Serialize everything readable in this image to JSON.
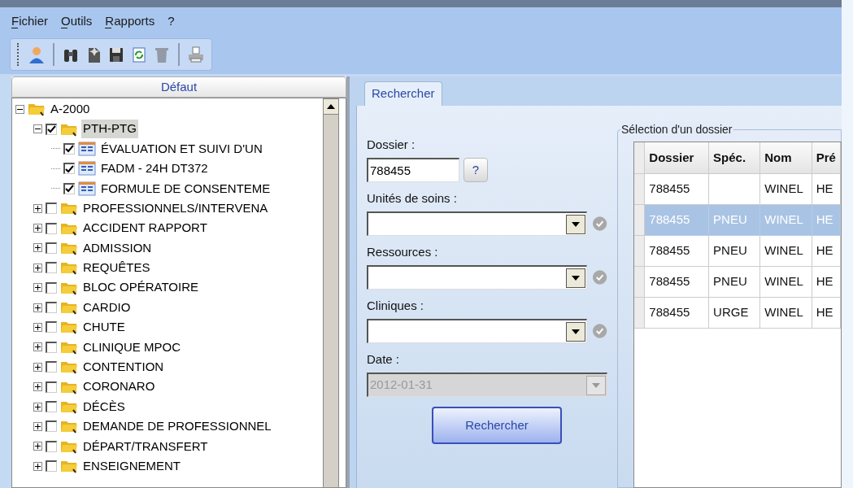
{
  "menu": [
    {
      "label": "Fichier",
      "mnemonic": true
    },
    {
      "label": "Outils",
      "mnemonic": true
    },
    {
      "label": "Rapports",
      "mnemonic": true
    },
    {
      "label": "?",
      "mnemonic": false
    }
  ],
  "toolbar": {
    "groups": [
      [
        {
          "disabled": false
        }
      ],
      [
        {
          "disabled": false
        },
        {
          "disabled": false
        },
        {
          "disabled": false
        },
        {
          "disabled": false
        },
        {
          "disabled": true
        }
      ],
      [
        {
          "disabled": false
        }
      ]
    ]
  },
  "tree": {
    "header": "Défaut",
    "items": [
      {
        "label": "A-2000",
        "kind": "root",
        "expanded": true,
        "selected": false,
        "children": [
          {
            "label": "PTH-PTG",
            "kind": "folder",
            "checked": true,
            "expanded": true,
            "selected": true,
            "children": [
              {
                "label": "ÉVALUATION ET SUIVI D'UN",
                "kind": "form",
                "checked": true,
                "selected": false
              },
              {
                "label": "FADM - 24H DT372",
                "kind": "form",
                "checked": true,
                "selected": false
              },
              {
                "label": "FORMULE DE CONSENTEME",
                "kind": "form",
                "checked": true,
                "selected": false
              }
            ]
          },
          {
            "label": "PROFESSIONNELS/INTERVENA",
            "kind": "folder",
            "checked": false,
            "expanded": false,
            "selected": false
          },
          {
            "label": "ACCIDENT RAPPORT",
            "kind": "folder",
            "checked": false,
            "expanded": false,
            "selected": false
          },
          {
            "label": "ADMISSION",
            "kind": "folder",
            "checked": false,
            "expanded": false,
            "selected": false
          },
          {
            "label": "REQUÊTES",
            "kind": "folder",
            "checked": false,
            "expanded": false,
            "selected": false
          },
          {
            "label": "BLOC OPÉRATOIRE",
            "kind": "folder",
            "checked": false,
            "expanded": false,
            "selected": false
          },
          {
            "label": "CARDIO",
            "kind": "folder",
            "checked": false,
            "expanded": false,
            "selected": false
          },
          {
            "label": "CHUTE",
            "kind": "folder",
            "checked": false,
            "expanded": false,
            "selected": false
          },
          {
            "label": "CLINIQUE MPOC",
            "kind": "folder",
            "checked": false,
            "expanded": false,
            "selected": false
          },
          {
            "label": "CONTENTION",
            "kind": "folder",
            "checked": false,
            "expanded": false,
            "selected": false
          },
          {
            "label": "CORONARO",
            "kind": "folder",
            "checked": false,
            "expanded": false,
            "selected": false
          },
          {
            "label": "DÉCÈS",
            "kind": "folder",
            "checked": false,
            "expanded": false,
            "selected": false
          },
          {
            "label": "DEMANDE DE PROFESSIONNEL",
            "kind": "folder",
            "checked": false,
            "expanded": false,
            "selected": false
          },
          {
            "label": "DÉPART/TRANSFERT",
            "kind": "folder",
            "checked": false,
            "expanded": false,
            "selected": false
          },
          {
            "label": "ENSEIGNEMENT",
            "kind": "folder",
            "checked": false,
            "expanded": false,
            "selected": false
          }
        ]
      }
    ]
  },
  "tabs": [
    {
      "label": "Rechercher",
      "selected": true
    }
  ],
  "form": {
    "fields": [
      {
        "label": "Dossier :",
        "kind": "text",
        "value": "788455",
        "help": "?"
      },
      {
        "label": "Unités de soins :",
        "kind": "combo"
      },
      {
        "label": "Ressources :",
        "kind": "combo"
      },
      {
        "label": "Cliniques :",
        "kind": "combo"
      },
      {
        "label": "Date :",
        "kind": "date",
        "value": "2012-01-31",
        "disabled": true
      }
    ],
    "button": "Rechercher"
  },
  "results": {
    "title": "Sélection d'un dossier",
    "columns": [
      "Dossier",
      "Spéc.",
      "Nom",
      "Pré"
    ],
    "rows": [
      {
        "cells": [
          "788455",
          "",
          "WINEL",
          "HE"
        ],
        "selected": false
      },
      {
        "cells": [
          "788455",
          "PNEU",
          "WINEL",
          "HE"
        ],
        "selected": true
      },
      {
        "cells": [
          "788455",
          "PNEU",
          "WINEL",
          "HE"
        ],
        "selected": false
      },
      {
        "cells": [
          "788455",
          "PNEU",
          "WINEL",
          "HE"
        ],
        "selected": false
      },
      {
        "cells": [
          "788455",
          "URGE",
          "WINEL",
          "HE"
        ],
        "selected": false
      }
    ]
  }
}
